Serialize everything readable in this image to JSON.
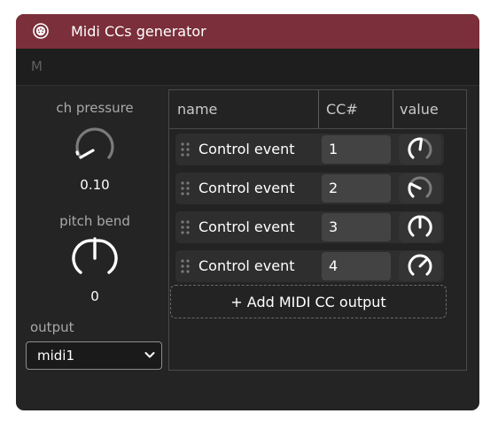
{
  "window": {
    "title": "Midi CCs generator",
    "icon": "midi-port-icon"
  },
  "toolbar": {
    "mode_letter": "M"
  },
  "left": {
    "pressure": {
      "label": "ch pressure",
      "value": "0.10",
      "level": 0.1
    },
    "pitch": {
      "label": "pitch bend",
      "value": "0",
      "level": 0.5
    },
    "output": {
      "label": "output",
      "selected": "midi1"
    }
  },
  "table": {
    "headers": {
      "name": "name",
      "cc": "CC#",
      "value": "value"
    },
    "rows": [
      {
        "name": "Control event",
        "cc": "1",
        "knob_level": 0.55
      },
      {
        "name": "Control event",
        "cc": "2",
        "knob_level": 0.2
      },
      {
        "name": "Control event",
        "cc": "3",
        "knob_level": 0.5
      },
      {
        "name": "Control event",
        "cc": "4",
        "knob_level": 0.68
      }
    ],
    "add_button": "+ Add MIDI CC output"
  },
  "colors": {
    "titlebar": "#7a2f3a",
    "panel": "#242424",
    "accent": "#ffffff"
  }
}
